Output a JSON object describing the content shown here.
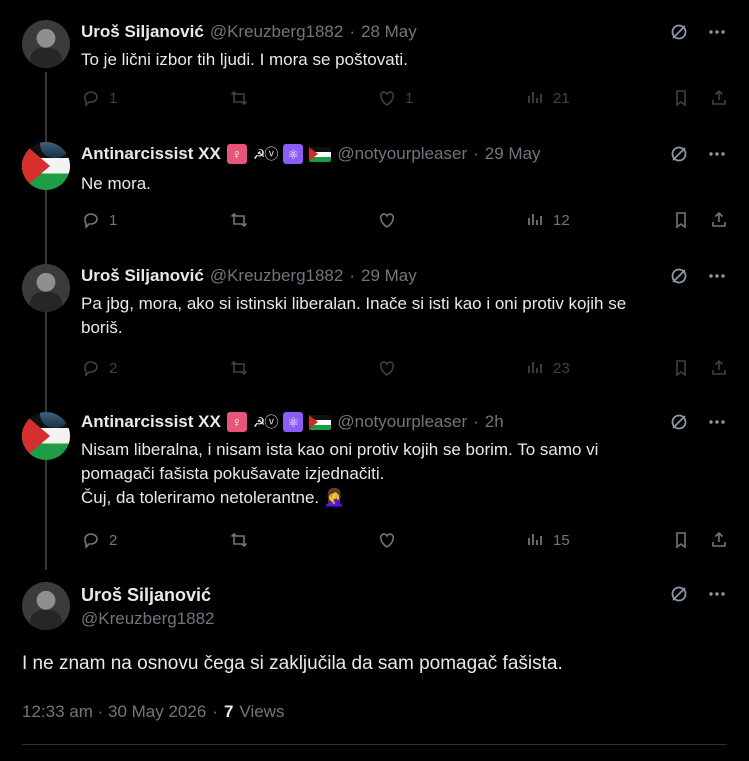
{
  "tweets": [
    {
      "name": "Uroš Siljanović",
      "handle": "@Kreuzberg1882",
      "sep": "·",
      "time": "28 May",
      "text": "To je lični izbor tih ljudi. I mora se poštovati.",
      "replies": "1",
      "reposts": "",
      "likes": "1",
      "views": "21"
    },
    {
      "name": "Antinarcissist XX",
      "handle": "@notyourpleaser",
      "sep": "·",
      "time": "29 May",
      "text": "Ne mora.",
      "replies": "1",
      "reposts": "",
      "likes": "",
      "views": "12",
      "badges": [
        "♀",
        "☭ⓥ",
        "⚛"
      ]
    },
    {
      "name": "Uroš Siljanović",
      "handle": "@Kreuzberg1882",
      "sep": "·",
      "time": "29 May",
      "text_lines": [
        "Pa jbg, mora, ako si istinski liberalan. Inače si isti kao i oni protiv kojih se",
        "boriš."
      ],
      "replies": "2",
      "reposts": "",
      "likes": "",
      "views": "23"
    },
    {
      "name": "Antinarcissist XX",
      "handle": "@notyourpleaser",
      "sep": "·",
      "time": "2h",
      "text_lines": [
        "Nisam liberalna, i nisam ista kao oni protiv kojih se borim. To samo vi",
        "pomagači fašista pokušavate izjednačiti.",
        "Čuj, da toleriramo netolerantne. 🤦‍♀️"
      ],
      "replies": "2",
      "reposts": "",
      "likes": "",
      "views": "15",
      "badges": [
        "♀",
        "☭ⓥ",
        "⚛"
      ]
    }
  ],
  "focus": {
    "name": "Uroš Siljanović",
    "handle": "@Kreuzberg1882",
    "text": "I ne znam na osnovu čega si zaključila da sam pomagač fašista.",
    "timestamp": "12:33 am · 30 May 2026",
    "sep": "·",
    "views_count": "7",
    "views_label": "Views"
  },
  "icons": [
    "grok-icon",
    "more-icon",
    "reply-icon",
    "repost-icon",
    "like-icon",
    "views-icon",
    "bookmark-icon",
    "share-icon"
  ]
}
